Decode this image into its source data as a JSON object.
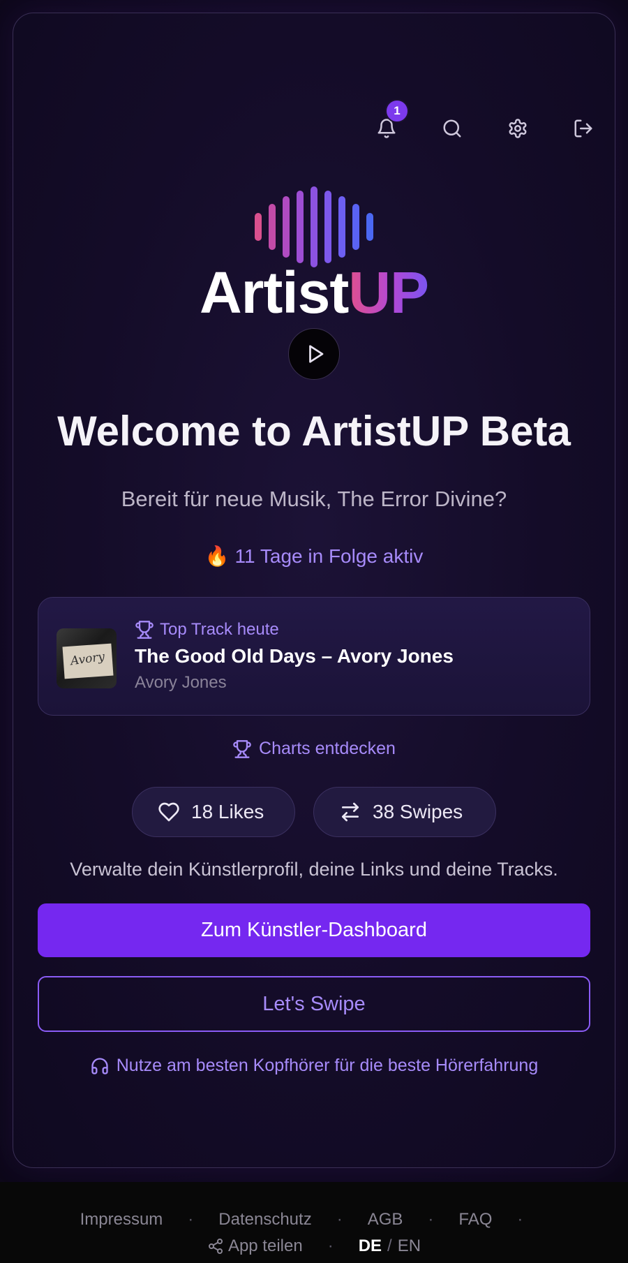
{
  "header": {
    "notification_count": "1",
    "icons": [
      "bell-icon",
      "search-icon",
      "gear-icon",
      "logout-icon"
    ]
  },
  "logo": {
    "part1": "Artist",
    "part2": "UP",
    "wave_colors": [
      "#d9508e",
      "#c24ba8",
      "#b04bc1",
      "#9e4ed4",
      "#8c52e0",
      "#7d58eb",
      "#6d5ff2",
      "#5a63f4",
      "#4b68f2"
    ]
  },
  "welcome": {
    "title": "Welcome to ArtistUP Beta",
    "subtitle": "Bereit für neue Musik, The Error Divine?",
    "streak_emoji": "🔥",
    "streak": "11 Tage in Folge aktiv"
  },
  "top_track": {
    "label": "Top Track heute",
    "title": "The Good Old Days – Avory Jones",
    "artist": "Avory Jones",
    "cover_signature": "Avory"
  },
  "charts_link": "Charts entdecken",
  "stats": {
    "likes": "18 Likes",
    "swipes": "38 Swipes"
  },
  "manage_text": "Verwalte dein Künstlerprofil, deine Links und deine Tracks.",
  "buttons": {
    "dashboard": "Zum Künstler-Dashboard",
    "swipe": "Let's Swipe"
  },
  "headphones_hint": "Nutze am besten Kopfhörer für die beste Hörerfahrung",
  "footer": {
    "links": [
      "Impressum",
      "Datenschutz",
      "AGB",
      "FAQ"
    ],
    "separator": "·",
    "share": "App teilen",
    "lang_de": "DE",
    "lang_slash": "/",
    "lang_en": "EN"
  },
  "colors": {
    "accent": "#7528f0",
    "accent_light": "#a78bfa",
    "background": "#120a24"
  }
}
